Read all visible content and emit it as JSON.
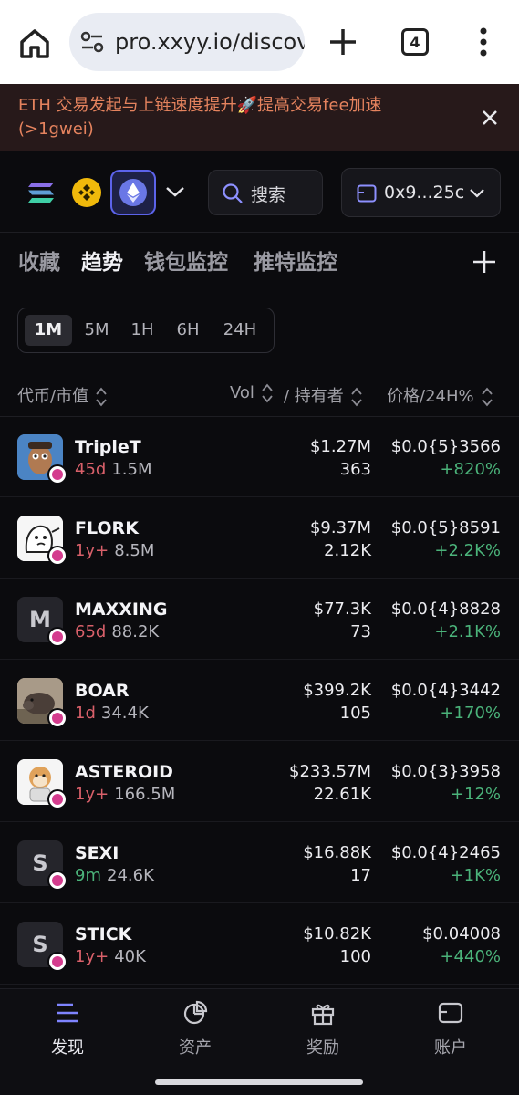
{
  "browser": {
    "url": "pro.xxyy.io/discov",
    "tab_count": "4"
  },
  "notice": {
    "text": "ETH 交易发起与上链速度提升🚀提高交易fee加速(>1gwei)"
  },
  "chains": {
    "items": [
      "solana-icon",
      "bnb-icon",
      "ethereum-icon"
    ],
    "selected": "ethereum"
  },
  "search": {
    "label": "搜索"
  },
  "wallet": {
    "address": "0x9...25c"
  },
  "tabs": [
    {
      "label": "收藏"
    },
    {
      "label": "趋势"
    },
    {
      "label": "钱包监控"
    },
    {
      "label": "推特监控"
    }
  ],
  "time_filter": [
    {
      "label": "1M"
    },
    {
      "label": "5M"
    },
    {
      "label": "1H"
    },
    {
      "label": "6H"
    },
    {
      "label": "24H"
    }
  ],
  "columns": {
    "token": "代币/市值",
    "vol": "Vol",
    "holders": "/ 持有者",
    "price": "价格/24H%"
  },
  "tokens": [
    {
      "name": "TripleT",
      "age": "45d",
      "mcap": "1.5M",
      "vol": "$1.27M",
      "holders": "363",
      "price": "$0.0{5}3566",
      "change": "+820%",
      "avatar": "tripleT-image"
    },
    {
      "name": "FLORK",
      "age": "1y+",
      "mcap": "8.5M",
      "vol": "$9.37M",
      "holders": "2.12K",
      "price": "$0.0{5}8591",
      "change": "+2.2K%",
      "avatar": "flork-image"
    },
    {
      "name": "MAXXING",
      "age": "65d",
      "mcap": "88.2K",
      "vol": "$77.3K",
      "holders": "73",
      "price": "$0.0{4}8828",
      "change": "+2.1K%",
      "avatar_letter": "M"
    },
    {
      "name": "BOAR",
      "age": "1d",
      "mcap": "34.4K",
      "vol": "$399.2K",
      "holders": "105",
      "price": "$0.0{4}3442",
      "change": "+170%",
      "avatar": "boar-image"
    },
    {
      "name": "ASTEROID",
      "age": "1y+",
      "mcap": "166.5M",
      "vol": "$233.57M",
      "holders": "22.61K",
      "price": "$0.0{3}3958",
      "change": "+12%",
      "avatar": "asteroid-image"
    },
    {
      "name": "SEXI",
      "age": "9m",
      "mcap": "24.6K",
      "vol": "$16.88K",
      "holders": "17",
      "price": "$0.0{4}2465",
      "change": "+1K%",
      "avatar_letter": "S"
    },
    {
      "name": "STICK",
      "age": "1y+",
      "mcap": "40K",
      "vol": "$10.82K",
      "holders": "100",
      "price": "$0.04008",
      "change": "+440%",
      "avatar_letter": "S"
    }
  ],
  "bottom_nav": [
    {
      "label": "发现",
      "icon": "discover-icon"
    },
    {
      "label": "资产",
      "icon": "assets-icon"
    },
    {
      "label": "奖励",
      "icon": "gift-icon"
    },
    {
      "label": "账户",
      "icon": "account-icon"
    }
  ],
  "colors": {
    "accent": "#5c63ea",
    "positive": "#4bb37a",
    "negative": "#d9606a",
    "notice": "#e5835e"
  }
}
